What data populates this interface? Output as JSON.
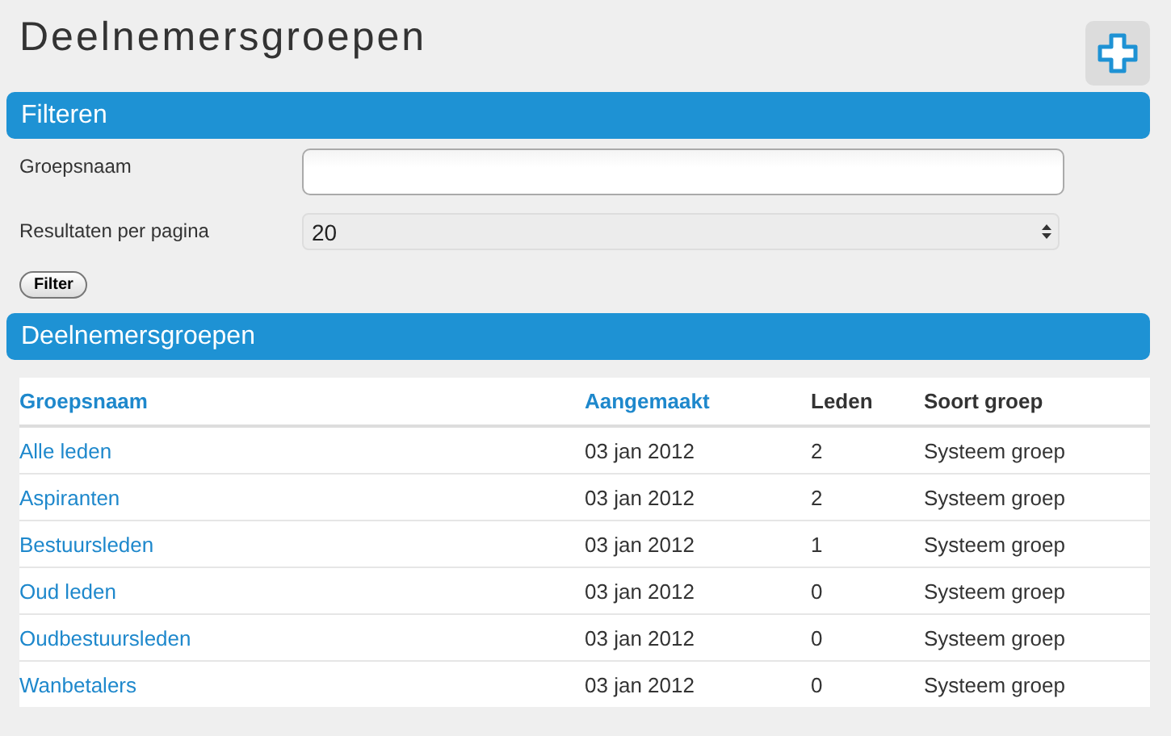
{
  "page_title": "Deelnemersgroepen",
  "filter_panel": {
    "title": "Filteren",
    "fields": [
      {
        "kind": "text",
        "label": "Groepsnaam"
      },
      {
        "kind": "select",
        "label": "Resultaten per pagina",
        "value": "20"
      }
    ],
    "button": "Filter"
  },
  "groups_panel": {
    "title": "Deelnemersgroepen",
    "table": {
      "columns": [
        {
          "label": "Groepsnaam",
          "sortable": true
        },
        {
          "label": "Aangemaakt",
          "sortable": true
        },
        {
          "label": "Leden",
          "sortable": false
        },
        {
          "label": "Soort groep",
          "sortable": false
        }
      ],
      "rows": [
        [
          "Alle leden",
          "03 jan 2012",
          "2",
          "Systeem groep"
        ],
        [
          "Aspiranten",
          "03 jan 2012",
          "2",
          "Systeem groep"
        ],
        [
          "Bestuursleden",
          "03 jan 2012",
          "1",
          "Systeem groep"
        ],
        [
          "Oud leden",
          "03 jan 2012",
          "0",
          "Systeem groep"
        ],
        [
          "Oudbestuursleden",
          "03 jan 2012",
          "0",
          "Systeem groep"
        ],
        [
          "Wanbetalers",
          "03 jan 2012",
          "0",
          "Systeem groep"
        ]
      ]
    }
  }
}
